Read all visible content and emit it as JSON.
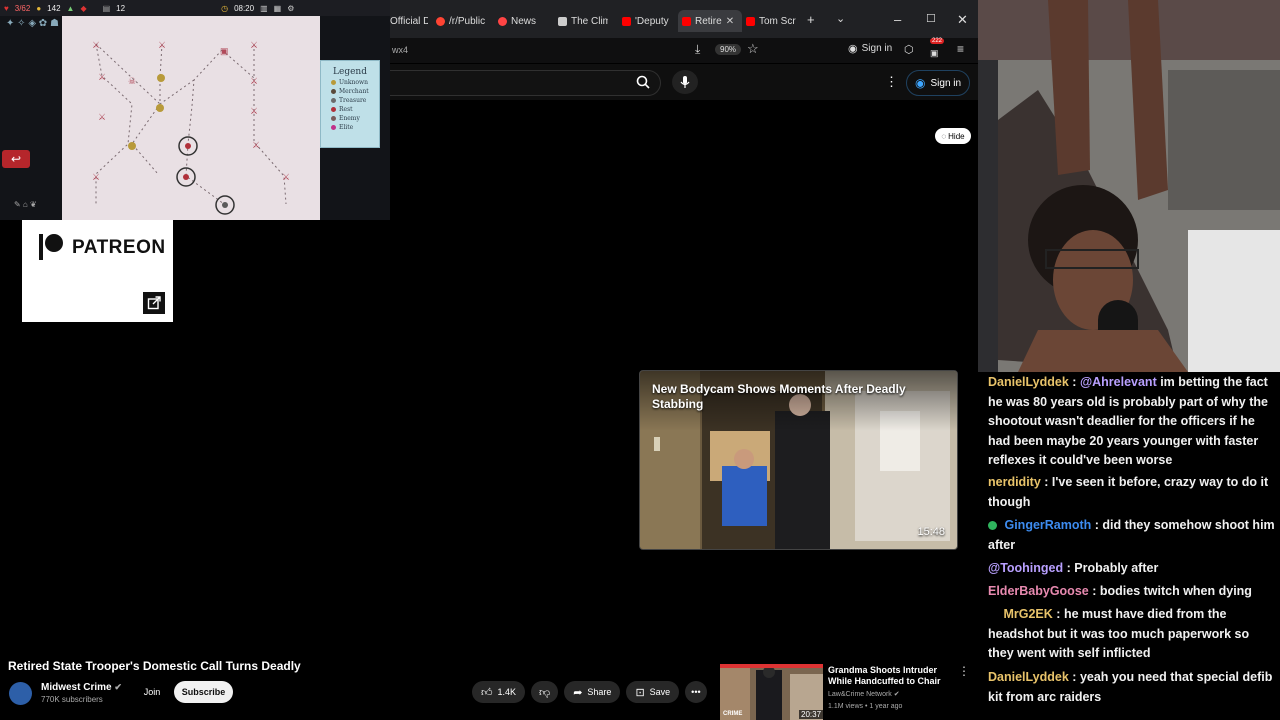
{
  "game": {
    "hud_health": "3/62",
    "hud_gold": "142",
    "hud_floor": "12",
    "hud_time": "08:20",
    "legend_title": "Legend",
    "legend_items": [
      {
        "label": "Unknown",
        "color": "#b89a3a"
      },
      {
        "label": "Merchant",
        "color": "#5a4a3a"
      },
      {
        "label": "Treasure",
        "color": "#6b6b6b"
      },
      {
        "label": "Rest",
        "color": "#b0303a"
      },
      {
        "label": "Enemy",
        "color": "#7a5a5a"
      },
      {
        "label": "Elite",
        "color": "#c0308a"
      }
    ]
  },
  "patreon": {
    "label": "PATREON"
  },
  "tabs": [
    {
      "label": "Official D",
      "color": "#e33"
    },
    {
      "label": "/r/Public",
      "color": "#f43"
    },
    {
      "label": "News",
      "color": "#f44"
    },
    {
      "label": "The Clim",
      "color": "#ccc"
    },
    {
      "label": "'Deputy",
      "color": "#f00"
    },
    {
      "label": "Retire",
      "color": "#f00"
    },
    {
      "label": "Tom Scr",
      "color": "#f00"
    }
  ],
  "address": {
    "url_fragment": "wx4",
    "zoom": "90%",
    "sign_in": "Sign in",
    "ext_count": "222"
  },
  "youtube": {
    "sign_in": "Sign in",
    "hide_label": "Hide",
    "card_title": "New Bodycam Shows Moments After Deadly Stabbing",
    "card_duration": "15:48",
    "video_title": "Retired State Trooper's Domestic Call Turns Deadly",
    "channel_name": "Midwest Crime",
    "channel_subs": "770K subscribers",
    "join_label": "Join",
    "subscribe_label": "Subscribe",
    "likes": "1.4K",
    "share_label": "Share",
    "save_label": "Save",
    "rec_title": "Grandma Shoots Intruder While Handcuffed to Chair",
    "rec_channel": "Law&Crime Network",
    "rec_meta": "1.1M views • 1 year ago",
    "rec_duration": "20:37",
    "rec_thumb_text": "CRIME"
  },
  "chat": [
    {
      "user": "DanielLyddek",
      "color": "#e8c36a",
      "text": "@Ahrelevant im betting the fact he was 80 years old is probably part of why the shootout wasn't deadlier for the officers if he had been maybe 20 years younger with faster reflexes it could've been worse",
      "mention": "@Ahrelevant",
      "mention_color": "#b9a0ff"
    },
    {
      "user": "nerdidity",
      "color": "#e8c36a",
      "text": "I've seen it before, crazy way to do it though"
    },
    {
      "user": "GingerRamoth",
      "color": "#3d8cf0",
      "text": "did they somehow shoot him after",
      "badge": "green"
    },
    {
      "user": "@Toohinged",
      "color": "#b9a0ff",
      "text": "Probably after"
    },
    {
      "user": "ElderBabyGoose",
      "color": "#e88ab0",
      "text": "bodies twitch when dying"
    },
    {
      "user": "MrG2EK",
      "color": "#e8c36a",
      "text": "he must have died from the headshot but it was too much paperwork so they went with self inflicted",
      "badge": "space"
    },
    {
      "user": "DanielLyddek",
      "color": "#e8c36a",
      "text": "yeah you need that special defib kit from arc raiders"
    }
  ]
}
